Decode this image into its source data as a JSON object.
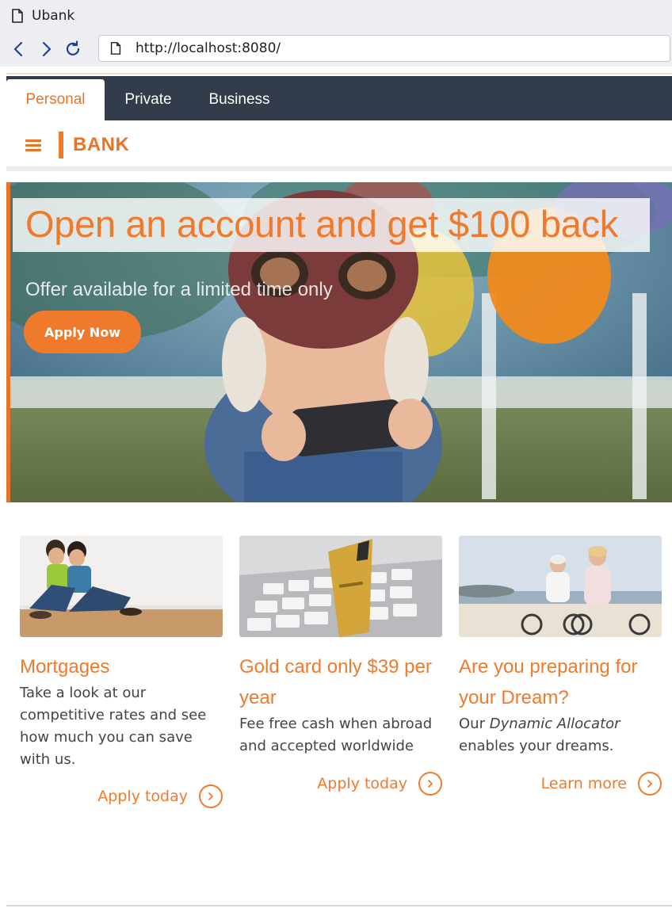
{
  "browser": {
    "tab_title": "Ubank",
    "url": "http://localhost:8080/"
  },
  "site_nav": {
    "tabs": [
      {
        "label": "Personal",
        "active": true
      },
      {
        "label": "Private",
        "active": false
      },
      {
        "label": "Business",
        "active": false
      }
    ]
  },
  "brand": {
    "name": "BANK"
  },
  "hero": {
    "title": "Open an account and get $100 back",
    "subtitle": "Offer available for a limited time only",
    "cta_label": "Apply Now"
  },
  "cards": [
    {
      "title": "Mortgages",
      "text": "Take a look at our competitive rates and see how much you can save with us.",
      "link_label": "Apply today"
    },
    {
      "title": "Gold card only $39 per year",
      "text": "Fee free cash when abroad and accepted worldwide",
      "link_label": "Apply today"
    },
    {
      "title": "Are you preparing for your Dream?",
      "text_before": "Our ",
      "text_em": "Dynamic Allocator",
      "text_after": "enables your dreams.",
      "link_label": "Learn more"
    }
  ],
  "colors": {
    "accent": "#f07a2c",
    "nav_bg": "#323c4a",
    "body_text": "#444444"
  }
}
